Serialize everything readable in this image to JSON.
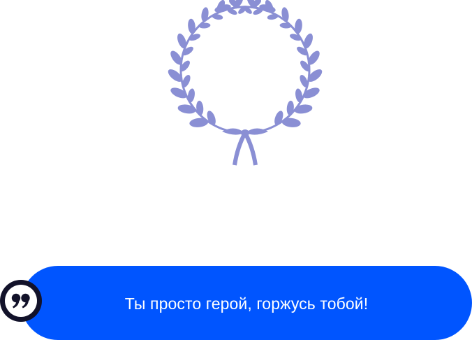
{
  "award": {
    "icon": "laurel-wreath-icon",
    "color": "#8a8fd4"
  },
  "message": {
    "text": "Ты просто герой, горжусь тобой!",
    "background": "#0055ff",
    "text_color": "#ffffff"
  },
  "quote_badge": {
    "icon": "quote-icon",
    "color": "#12122a"
  }
}
